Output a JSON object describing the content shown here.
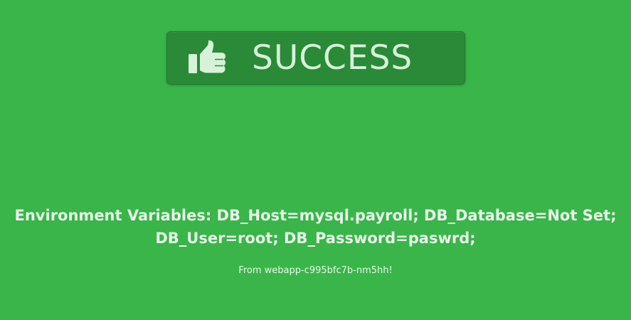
{
  "banner": {
    "text": "SUCCESS",
    "icon": "thumbs-up-icon",
    "background_color": "#2a8a37",
    "text_color": "#d6f3d9"
  },
  "page": {
    "background_color": "#39b54a"
  },
  "env": {
    "line1": "Environment Variables: DB_Host=mysql.payroll; DB_Database=Not Set;",
    "line2": "DB_User=root; DB_Password=paswrd;"
  },
  "footer": {
    "from_text": "From webapp-c995bfc7b-nm5hh!"
  }
}
